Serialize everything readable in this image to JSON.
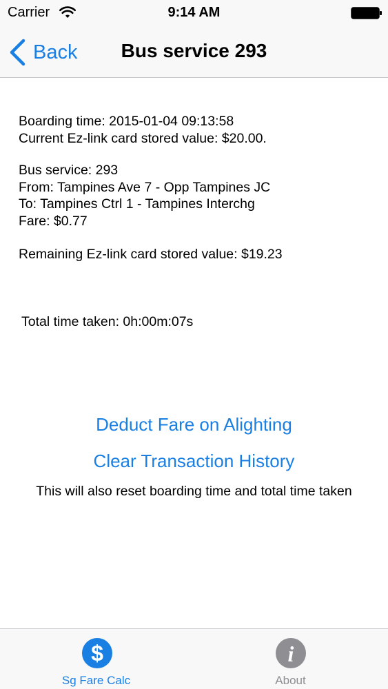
{
  "status_bar": {
    "carrier": "Carrier",
    "time": "9:14 AM"
  },
  "nav": {
    "back_label": "Back",
    "title": "Bus service 293"
  },
  "card": {
    "boarding_time": "Boarding time: 2015-01-04 09:13:58",
    "current_value": "Current Ez-link card stored value: $20.00."
  },
  "trip": {
    "bus_service": "Bus service: 293",
    "from": "From: Tampines Ave 7 - Opp Tampines JC",
    "to": "To: Tampines Ctrl 1 - Tampines Interchg",
    "fare": "Fare: $0.77"
  },
  "remaining": {
    "value": "Remaining Ez-link card stored value: $19.23"
  },
  "timer": {
    "total_time": "Total time taken: 0h:00m:07s"
  },
  "actions": {
    "deduct_label": "Deduct Fare on Alighting",
    "clear_label": "Clear Transaction History",
    "reset_note": "This will also reset boarding time and total time taken"
  },
  "tab_bar": {
    "tabs": [
      {
        "label": "Sg Fare Calc",
        "icon": "dollar-icon",
        "selected": true
      },
      {
        "label": "About",
        "icon": "info-icon",
        "selected": false
      }
    ]
  },
  "colors": {
    "accent": "#1a7fe3",
    "inactive": "#8e8e93",
    "bar_background": "#f8f8f8"
  }
}
